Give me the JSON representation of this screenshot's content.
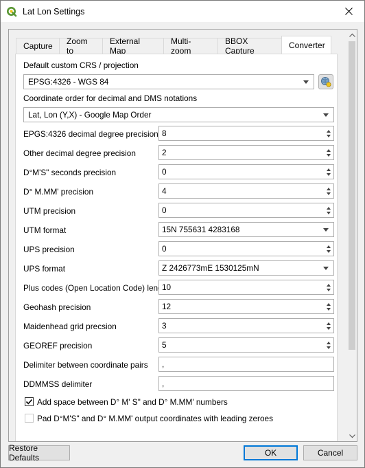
{
  "window": {
    "title": "Lat Lon Settings"
  },
  "tabs": [
    {
      "label": "Capture"
    },
    {
      "label": "Zoom to"
    },
    {
      "label": "External Map"
    },
    {
      "label": "Multi-zoom"
    },
    {
      "label": "BBOX Capture"
    },
    {
      "label": "Converter",
      "active": true
    }
  ],
  "converter": {
    "crs_label": "Default custom CRS / projection",
    "crs_value": "EPSG:4326 - WGS 84",
    "order_label": "Coordinate order for decimal and DMS notations",
    "order_value": "Lat, Lon (Y,X) - Google Map Order",
    "fields": [
      {
        "label": "EPGS:4326 decimal degree precision",
        "type": "spin",
        "value": "8"
      },
      {
        "label": "Other decimal degree precision",
        "type": "spin",
        "value": "2"
      },
      {
        "label": "D°M'S\" seconds precision",
        "type": "spin",
        "value": "0"
      },
      {
        "label": "D° M.MM' precision",
        "type": "spin",
        "value": "4"
      },
      {
        "label": "UTM precision",
        "type": "spin",
        "value": "0"
      },
      {
        "label": "UTM format",
        "type": "combo",
        "value": "15N 755631 4283168"
      },
      {
        "label": "UPS precision",
        "type": "spin",
        "value": "0"
      },
      {
        "label": "UPS format",
        "type": "combo",
        "value": "Z 2426773mE 1530125mN"
      },
      {
        "label": "Plus codes (Open Location Code) length",
        "type": "spin",
        "value": "10"
      },
      {
        "label": "Geohash precision",
        "type": "spin",
        "value": "12"
      },
      {
        "label": "Maidenhead grid precsion",
        "type": "spin",
        "value": "3"
      },
      {
        "label": "GEOREF precision",
        "type": "spin",
        "value": "5"
      },
      {
        "label": "Delimiter between coordinate pairs",
        "type": "text",
        "value": ","
      },
      {
        "label": "DDMMSS delimiter",
        "type": "text",
        "value": ","
      }
    ],
    "checkboxes": [
      {
        "label": "Add space between D° M' S\" and D° M.MM' numbers",
        "checked": true
      },
      {
        "label": "Pad D°M'S\" and D° M.MM' output coordinates with leading zeroes",
        "checked": false
      }
    ]
  },
  "buttons": {
    "restore": "Restore Defaults",
    "ok": "OK",
    "cancel": "Cancel"
  },
  "icons": {
    "app": "qgis-icon",
    "close": "close-icon",
    "crs": "projection-selector-icon"
  },
  "colors": {
    "qgis_green": "#589632",
    "qgis_yellow": "#f0c419",
    "focus_blue": "#0078d7"
  }
}
